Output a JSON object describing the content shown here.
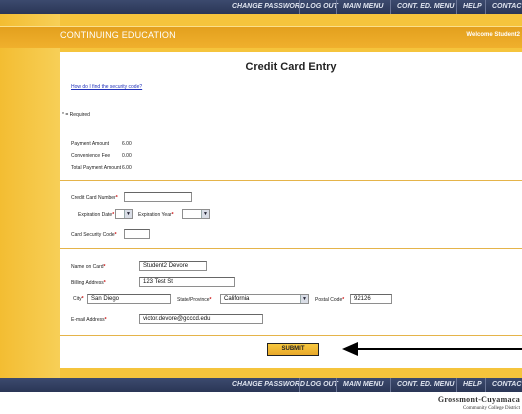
{
  "nav": {
    "items": [
      "Change Password",
      "Log Out",
      "Main Menu",
      "Cont. Ed. Menu",
      "Help",
      "Contact Us"
    ]
  },
  "header": {
    "brand": "CONTINUING EDUCATION",
    "welcome": "Welcome Student2"
  },
  "page": {
    "title": "Credit Card Entry",
    "security_link": "How do I find the security code?",
    "required_note": "* = Required"
  },
  "payment": {
    "amount_label": "Payment Amount",
    "amount_value": "6.00",
    "fee_label": "Convenience Fee",
    "fee_value": "0.00",
    "total_label": "Total Payment Amount",
    "total_value": "6.00"
  },
  "card": {
    "number_label": "Credit Card Number",
    "number_value": "",
    "exp_date_label": "Expiration Date",
    "exp_date_value": "",
    "exp_year_label": "Expiration Year",
    "exp_year_value": "",
    "security_label": "Card Security Code",
    "security_value": ""
  },
  "billing": {
    "name_label": "Name on Card",
    "name_value": "Student2 Devore",
    "address_label": "Billing Address",
    "address_value": "123 Test St",
    "city_label": "City",
    "city_value": "San Diego",
    "state_label": "State/Province",
    "state_value": "California",
    "postal_label": "Postal Code",
    "postal_value": "92126",
    "email_label": "E-mail Address",
    "email_value": "victor.devore@gcccd.edu"
  },
  "required_marker": "*",
  "submit_label": "SUBMIT",
  "footer": {
    "logo_line1": "Grossmont-Cuyamaca",
    "logo_line2": "Community College District"
  },
  "colors": {
    "gold": "#f5c43c",
    "nav": "#2f3b5e",
    "link": "#2233bb"
  }
}
